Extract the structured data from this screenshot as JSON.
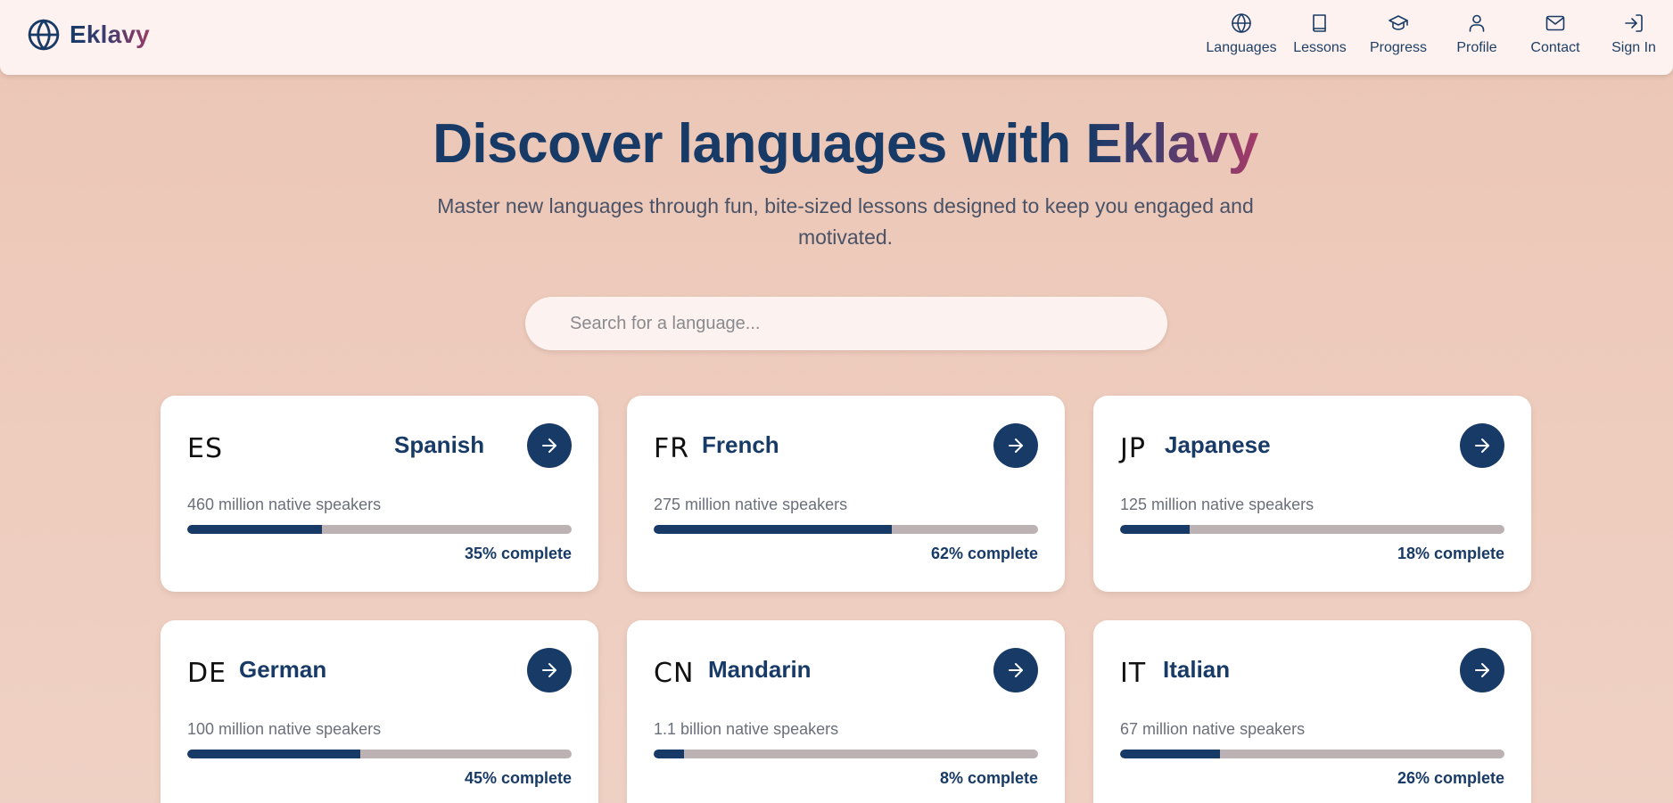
{
  "brand": {
    "name": "Eklavy",
    "icon": "globe-icon"
  },
  "nav": [
    {
      "label": "Languages",
      "icon": "globe-icon"
    },
    {
      "label": "Lessons",
      "icon": "book-icon"
    },
    {
      "label": "Progress",
      "icon": "graduation-cap-icon"
    },
    {
      "label": "Profile",
      "icon": "user-icon"
    },
    {
      "label": "Contact",
      "icon": "mail-icon"
    },
    {
      "label": "Sign In",
      "icon": "sign-in-icon"
    }
  ],
  "hero": {
    "title_prefix": "Discover languages with ",
    "title_brand": "Eklavy",
    "subtitle": "Master new languages through fun, bite-sized lessons designed to keep you engaged and motivated."
  },
  "search": {
    "placeholder": "Search for a language...",
    "value": ""
  },
  "languages": [
    {
      "code": "ES",
      "name": "Spanish",
      "speakers": "460 million native speakers",
      "progress": 35,
      "progress_label": "35% complete"
    },
    {
      "code": "FR",
      "name": "French",
      "speakers": "275 million native speakers",
      "progress": 62,
      "progress_label": "62% complete"
    },
    {
      "code": "JP",
      "name": "Japanese",
      "speakers": "125 million native speakers",
      "progress": 18,
      "progress_label": "18% complete"
    },
    {
      "code": "DE",
      "name": "German",
      "speakers": "100 million native speakers",
      "progress": 45,
      "progress_label": "45% complete"
    },
    {
      "code": "CN",
      "name": "Mandarin",
      "speakers": "1.1 billion native speakers",
      "progress": 8,
      "progress_label": "8% complete"
    },
    {
      "code": "IT",
      "name": "Italian",
      "speakers": "67 million native speakers",
      "progress": 26,
      "progress_label": "26% complete"
    }
  ],
  "colors": {
    "primary": "#183a66",
    "accent": "#a63b68",
    "track": "#bcb2b4"
  }
}
